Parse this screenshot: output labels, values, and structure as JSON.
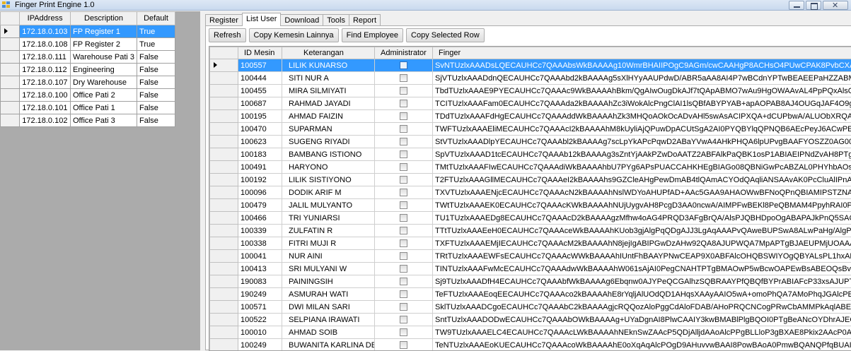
{
  "window": {
    "title": "Finger Print Engine 1.0"
  },
  "left_grid": {
    "headers": [
      "IPAddress",
      "Description",
      "Default"
    ],
    "rows": [
      {
        "ip": "172.18.0.103",
        "desc": "FP Register 1",
        "def": "True"
      },
      {
        "ip": "172.18.0.108",
        "desc": "FP Register 2",
        "def": "True"
      },
      {
        "ip": "172.18.0.111",
        "desc": "Warehouse Pati 3",
        "def": "False"
      },
      {
        "ip": "172.18.0.112",
        "desc": "Engineering",
        "def": "False"
      },
      {
        "ip": "172.18.0.107",
        "desc": "Dry Warehouse",
        "def": "False"
      },
      {
        "ip": "172.18.0.100",
        "desc": "Office Pati 2",
        "def": "False"
      },
      {
        "ip": "172.18.0.101",
        "desc": "Office Pati 1",
        "def": "False"
      },
      {
        "ip": "172.18.0.102",
        "desc": "Office Pati 3",
        "def": "False"
      }
    ]
  },
  "tabs": [
    "Register",
    "List User",
    "Download",
    "Tools",
    "Report"
  ],
  "active_tab": "List User",
  "toolbar": {
    "refresh": "Refresh",
    "copy_kemesin": "Copy Kemesin Lainnya",
    "find_employee": "Find Employee",
    "copy_selected": "Copy Selected Row"
  },
  "main_grid": {
    "headers": [
      "ID Mesin",
      "Keterangan",
      "Administrator",
      "Finger"
    ],
    "rows": [
      {
        "id": "100557",
        "name": "LILIK KUNARSO",
        "fp": "SvNTUzlxAAADsLQECAUHCc7QAAAbsWkBAAAAg10WmrBHAIIPOgC9AGm/cwCAAHgP8ACHsO4PUwCPAK8PvbCXABAPeQBeAHa/("
      },
      {
        "id": "100444",
        "name": "SITI NUR A",
        "fp": "SjVTUzlxAAADdnQECAUHCc7QAAAbd2kBAAAAg5sXlHYyAAUPdwD/ABR5aAA8AI4P7wBCdnYPTwBEAEEPaHZZABMOgClAJN4Q8"
      },
      {
        "id": "100455",
        "name": "MIRA SILMIYATI",
        "fp": "TbdTUzlxAAAE9PYECAUHCc7QAAAc9WkBAAAAhBkm/QgAIwOugDkAJf7tQApABMO7wAu9HgOWAAvAL4PpPQxAlsOMQDxAP/6agA"
      },
      {
        "id": "100687",
        "name": "RAHMAD JAYADI",
        "fp": "TCITUzlxAAAFam0ECAUHCc7QAAAda2kBAAAAhZc3iWokAlcPngClAI1lsQBfABYPYAB+apAOPAB8AJ4OUGqJAF4O9gBMAJtkMwCKAC"
      },
      {
        "id": "100195",
        "name": "AHMAD FAIZIN",
        "fp": "TDdTUzlxAAAFdHgECAUHCc7QAAAddWkBAAAAhZk3MHQoAOkOcADvAHl5swAsACIPXQA+dCUPbwA/ALUObXRQAE0PpQCmADZ6"
      },
      {
        "id": "100470",
        "name": "SUPARMAN",
        "fp": "TWFTUzlxAAAEliMECAUHCc7QAAAcI2kBAAAAhM8kUyliAjQPuwDpACUtSgA2AI0PYQBYlqQPNQB6AEcPeyJ6ACwPEwBHAPot5ACG/"
      },
      {
        "id": "100623",
        "name": "SUGENG RIYADI",
        "fp": "StVTUzlxAAADlpYECAUHCc7QAAAbl2kBAAAAg7scLpYkAPcPqwD2ABaYVwA4AHkPHQA6lpUPvgBAAFYOSZZ0AG00NACZA06YMA"
      },
      {
        "id": "100183",
        "name": "BAMBANG ISTIONO",
        "fp": "SpVTUzlxAAAD1tcECAUHCc7QAAAb12kBAAAAg3sZntYjAAkPZwDoAATZ2ABFAlkPaQBK1osP1ABIAEIPNdZvAH8PTgBFAILZWACIAA"
      },
      {
        "id": "100491",
        "name": "HARYONO",
        "fp": "TMtTUzlxAAAFIwECAUHCc7QAAAdiWkBAAAAhbU7PYg6APsPUACCAHKHEgBIAGo08QBNiGwPcABZAL0PHYhbAOsOUQC1AP2HlGI"
      },
      {
        "id": "100192",
        "name": "LILIK SISTIYONO",
        "fp": "T2FTUzlxAAAGllMECAUHCc7QAAAeI2kBAAAAhs9GZCleAHgPewDmAB4tlQAmACYOdQAqliANSAAvAK0PcCluAlIPnADxAKlvfAA4AJMF"
      },
      {
        "id": "100096",
        "name": "DODIK ARIF M",
        "fp": "TXVTUzlxAAAENjcECAUHCc7QAAAcN2kBAAAAhNslWDYoAHUPfAD+AAc5GAA9AHAOWwBFNoQPnQBIAMIPSTZNAPUPGgCKAOs4"
      },
      {
        "id": "100479",
        "name": "JALIL MULYANTO",
        "fp": "TWtTUzlxAAAEK0ECAUHCc7QAAAcKWkBAAAAhNUjUygvAH8PcgD3AA0ncwA/AIMPFwBEKl8PeQBMAM4PpyhRAI0PtgChABcniQB"
      },
      {
        "id": "100466",
        "name": "TRI YUNIARSI",
        "fp": "TU1TUzlxAAAEDg8ECAUHCc7QAAAcD2kBAAAAgzMfhw4oAG4PRQD3AFgBrQA/AlsPJQBHDpoOgABAPAJkPnQ5SAGYPTQCcAFABsA"
      },
      {
        "id": "100339",
        "name": "ZULFATIN R",
        "fp": "TTtTUzlxAAAEeH0ECAUHCc7QAAAceWkBAAAAhKUob3gjAlgPqQDgAJJ3LgAqAAAPvQAweBUPSwA8ALwPaHg/AlgPHwCKAPZ31AB"
      },
      {
        "id": "100338",
        "name": "FITRI MUJI R",
        "fp": "TXFTUzlxAAAEMjIECAUHCc7QAAAcM2kBAAAAhN8jejIgABIPGwDzAHw92QA8AJUPWQA7MpAPTgBJAEUPMjUOAAAPvgCfABA9tQBb"
      },
      {
        "id": "100041",
        "name": "NUR AINI",
        "fp": "TRtTUzlxAAAEWFsECAUHCc7QAAAcWWkBAAAAhIUntFhBAAYPNwCEAP9X0ABFAlcOHQBSWIYOgQBYALsPL1hxAPUPcgC1AHhXO"
      },
      {
        "id": "100413",
        "name": "SRI MULYANI W",
        "fp": "TINTUzlxAAAFwMcECAUHCc7QAAAdwWkBAAAAhW061sAjAI0PegCNAHTPTgBMAOwP5wBcwOAPEwBsABEOQsBvAOYPFwC9AM3"
      },
      {
        "id": "190083",
        "name": "PAININGSIH",
        "fp": "Sj9TUzlxAAADfH4ECAUHCc7QAAAbfWkBAAAAg6Ebqnw0AJYPeQCGAlhzSQBRAAYPfQBQfBYPrABIAFcP33xsAJUPTwC7AHRzkQCKA"
      },
      {
        "id": "190249",
        "name": "ASMURAH WATI",
        "fp": "TeFTUzlxAAAEoqEECAUHCc7QAAAco2kBAAAAhE8rYqljAlUOdQD1AHqsXAAyAAIO5wA+omoPhQA7AMoPhqJGAlcPEwCMAO+tOQBIA"
      },
      {
        "id": "100571",
        "name": "DWI MILAN SARI",
        "fp": "SklTUzlxAAADCgoECAUHCc7QAAAbC2kBAAAAgjcRQQozAloPggCdAloFDAB/AHoPRQCNCogPRwCbAMMPkAqlABEPUgB0AIMFDAC("
      },
      {
        "id": "100522",
        "name": "SELPIANA IRAWATI",
        "fp": "SntTUzlxAAADODwECAUHCc7QAAAbOWkBAAAAg+UYaDgnAI8PlwCAAIY3kwBMABlPlgBQOI0PTgBeANcOYDhrAJEOLQCwAH43qwB"
      },
      {
        "id": "100010",
        "name": "AHMAD SOIB",
        "fp": "TW9TUzlxAAAELC4ECAUHCc7QAAAcLWkBAAAAhNEknSwZAAcP5QDjAlljdAAoAlcPPgBLLloP3gBXAE8Pkix2AAcP0ABJAI8jkQCsAAc"
      },
      {
        "id": "100249",
        "name": "BUWANITA KARLINA DEW",
        "fp": "TeNTUzlxAAAEoKUECAUHCc7QAAAcoWkBAAAAhE0oXqAqAlcPOgD9AHuvvwBAAI8PowBAoA0PmwBQANQPfqBUAIwPJQC3AHKutA"
      }
    ]
  }
}
